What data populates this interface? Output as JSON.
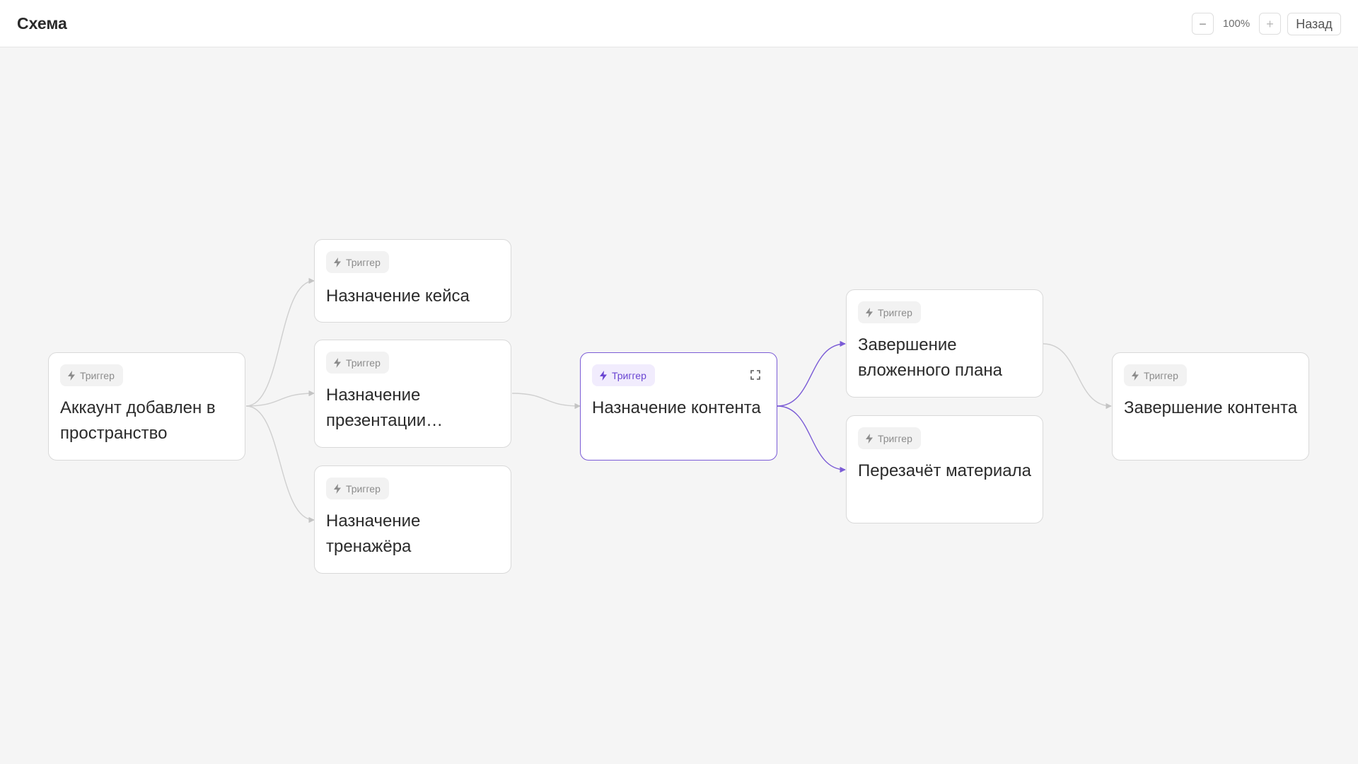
{
  "header": {
    "title": "Схема",
    "zoom_out_label": "−",
    "zoom_level": "100%",
    "zoom_in_label": "+",
    "back_label": "Назад"
  },
  "diagram": {
    "nodes": [
      {
        "id": "account-added",
        "badge": "Триггер",
        "title": "Аккаунт добавлен в пространство"
      },
      {
        "id": "case-assign",
        "badge": "Триггер",
        "title": "Назначение кейса"
      },
      {
        "id": "presentation-assign",
        "badge": "Триггер",
        "title": "Назначение презентации…"
      },
      {
        "id": "simulator-assign",
        "badge": "Триггер",
        "title": "Назначение тренажёра"
      },
      {
        "id": "content-assign",
        "badge": "Триггер",
        "title": "Назначение контента",
        "active": true
      },
      {
        "id": "nested-plan-complete",
        "badge": "Триггер",
        "title": "Завершение вложенного плана"
      },
      {
        "id": "material-recount",
        "badge": "Триггер",
        "title": "Перезачёт материала"
      },
      {
        "id": "content-complete",
        "badge": "Триггер",
        "title": "Завершение контента"
      }
    ],
    "edges": [
      {
        "from": "account-added",
        "to": "case-assign"
      },
      {
        "from": "account-added",
        "to": "presentation-assign"
      },
      {
        "from": "account-added",
        "to": "simulator-assign"
      },
      {
        "from": "presentation-assign",
        "to": "content-assign"
      },
      {
        "from": "content-assign",
        "to": "nested-plan-complete"
      },
      {
        "from": "content-assign",
        "to": "material-recount"
      },
      {
        "from": "nested-plan-complete",
        "to": "content-complete"
      }
    ]
  },
  "colors": {
    "accent": "#7b5cd6",
    "edge": "#c8c8c8",
    "canvas_bg": "#f5f5f5"
  },
  "icons": {
    "badge": "bolt-icon",
    "expand": "expand-icon"
  }
}
